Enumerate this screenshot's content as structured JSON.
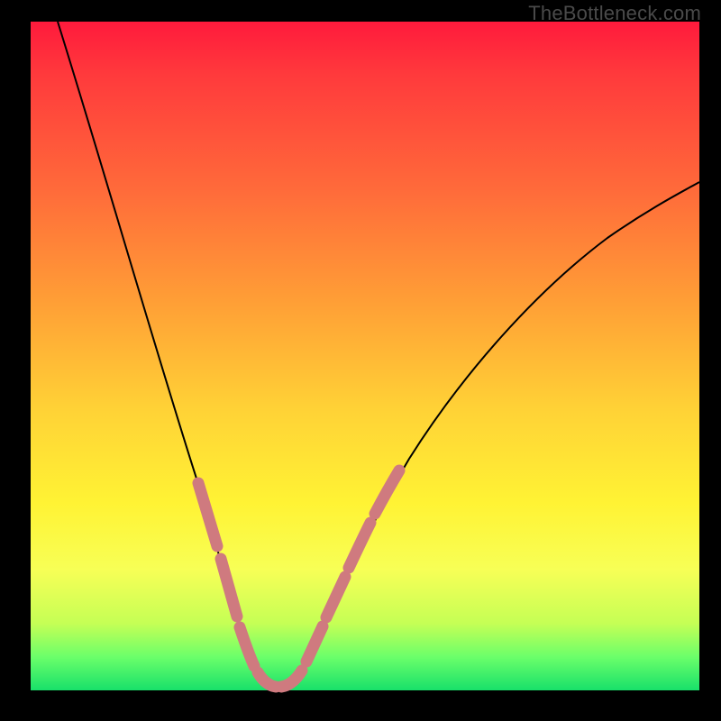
{
  "watermark": "TheBottleneck.com",
  "colors": {
    "background": "#000000",
    "curve": "#000000",
    "highlight": "#cf7a7f",
    "gradient_stops": [
      "#ff1a3c",
      "#ff3a3c",
      "#ff6a3a",
      "#ff9f36",
      "#ffd236",
      "#fff334",
      "#f7ff56",
      "#c5ff55",
      "#6bff6a",
      "#18e06a"
    ]
  },
  "chart_data": {
    "type": "line",
    "title": "",
    "xlabel": "",
    "ylabel": "",
    "xlim": [
      0,
      100
    ],
    "ylim": [
      0,
      100
    ],
    "grid": false,
    "legend": false,
    "series": [
      {
        "name": "bottleneck-curve",
        "x": [
          4,
          8,
          12,
          16,
          20,
          24,
          26,
          28,
          30,
          32,
          34,
          36,
          38,
          40,
          45,
          50,
          55,
          60,
          65,
          70,
          75,
          80,
          85,
          90,
          95,
          100
        ],
        "y": [
          100,
          87,
          74,
          61,
          48,
          34,
          27,
          20,
          12,
          6,
          2,
          0,
          0,
          2,
          8,
          16,
          24,
          31,
          38,
          44,
          50,
          55,
          60,
          64,
          68,
          72
        ]
      }
    ],
    "highlighted_segments": {
      "description": "Pink overlay segments on the curve near the valley walls and floor",
      "x_ranges": [
        [
          24,
          30
        ],
        [
          30,
          40
        ],
        [
          40,
          48
        ]
      ]
    },
    "background_scale": {
      "description": "Vertical color gradient encodes badness: red (top, high) → green (bottom, low)"
    }
  }
}
